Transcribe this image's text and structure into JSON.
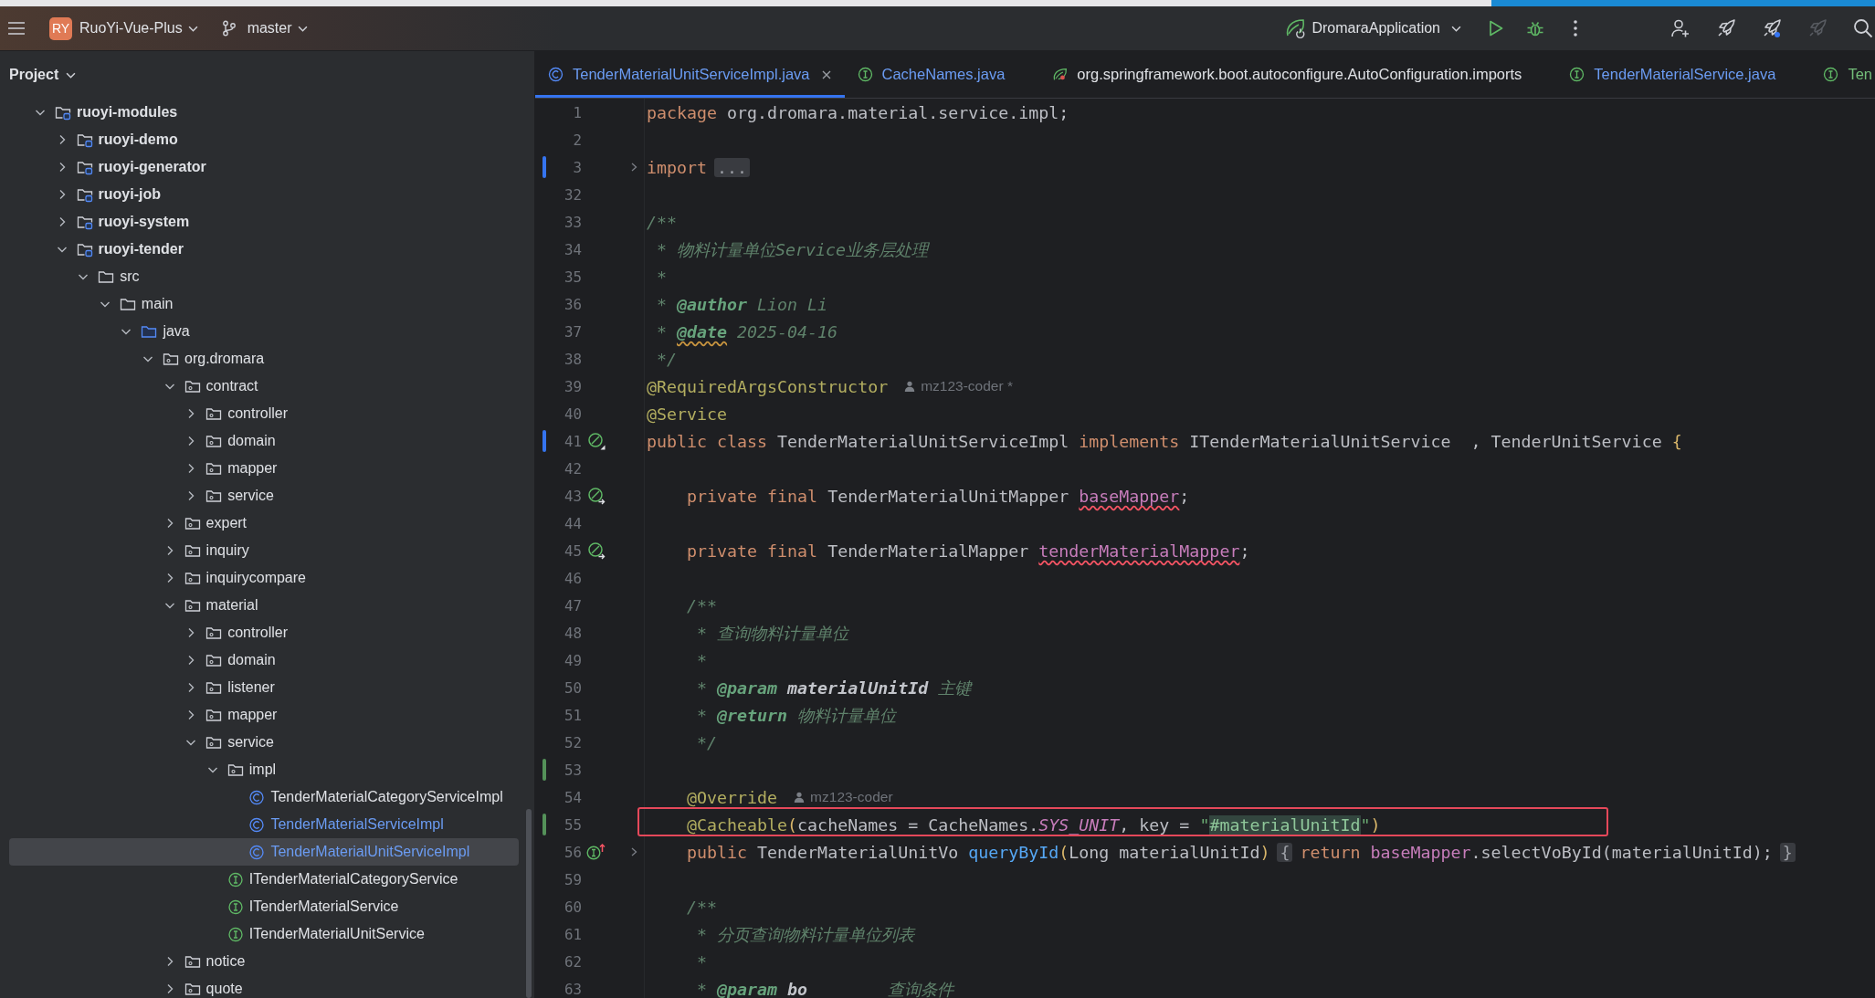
{
  "title_bar": {
    "project_badge": "RY",
    "project": "RuoYi-Vue-Plus",
    "branch": "master",
    "run_config": "DromaraApplication",
    "actions": [
      {
        "kind": "add-user",
        "disabled": false
      },
      {
        "kind": "rocket",
        "disabled": false
      },
      {
        "kind": "rocket-badge",
        "disabled": false
      },
      {
        "kind": "rocket",
        "disabled": true
      },
      {
        "kind": "search",
        "disabled": false
      }
    ]
  },
  "project_panel": {
    "title": "Project",
    "tree": [
      {
        "label": "ruoyi-modules",
        "kind": "module",
        "expanded": true,
        "selected": false,
        "children": [
          {
            "label": "ruoyi-demo",
            "kind": "module",
            "expanded": false,
            "selected": false
          },
          {
            "label": "ruoyi-generator",
            "kind": "module",
            "expanded": false,
            "selected": false
          },
          {
            "label": "ruoyi-job",
            "kind": "module",
            "expanded": false,
            "selected": false
          },
          {
            "label": "ruoyi-system",
            "kind": "module",
            "expanded": false,
            "selected": false
          },
          {
            "label": "ruoyi-tender",
            "kind": "module",
            "expanded": true,
            "selected": false,
            "children": [
              {
                "label": "src",
                "kind": "folder",
                "expanded": true,
                "selected": false,
                "children": [
                  {
                    "label": "main",
                    "kind": "folder",
                    "expanded": true,
                    "selected": false,
                    "children": [
                      {
                        "label": "java",
                        "kind": "source-root",
                        "expanded": true,
                        "selected": false,
                        "children": [
                          {
                            "label": "org.dromara",
                            "kind": "package",
                            "expanded": true,
                            "selected": false,
                            "children": [
                              {
                                "label": "contract",
                                "kind": "package",
                                "expanded": true,
                                "selected": false,
                                "children": [
                                  {
                                    "label": "controller",
                                    "kind": "package",
                                    "expanded": false,
                                    "selected": false
                                  },
                                  {
                                    "label": "domain",
                                    "kind": "package",
                                    "expanded": false,
                                    "selected": false
                                  },
                                  {
                                    "label": "mapper",
                                    "kind": "package",
                                    "expanded": false,
                                    "selected": false
                                  },
                                  {
                                    "label": "service",
                                    "kind": "package",
                                    "expanded": false,
                                    "selected": false
                                  }
                                ]
                              },
                              {
                                "label": "expert",
                                "kind": "package",
                                "expanded": false,
                                "selected": false
                              },
                              {
                                "label": "inquiry",
                                "kind": "package",
                                "expanded": false,
                                "selected": false
                              },
                              {
                                "label": "inquirycompare",
                                "kind": "package",
                                "expanded": false,
                                "selected": false
                              },
                              {
                                "label": "material",
                                "kind": "package",
                                "expanded": true,
                                "selected": false,
                                "children": [
                                  {
                                    "label": "controller",
                                    "kind": "package",
                                    "expanded": false,
                                    "selected": false
                                  },
                                  {
                                    "label": "domain",
                                    "kind": "package",
                                    "expanded": false,
                                    "selected": false
                                  },
                                  {
                                    "label": "listener",
                                    "kind": "package",
                                    "expanded": false,
                                    "selected": false
                                  },
                                  {
                                    "label": "mapper",
                                    "kind": "package",
                                    "expanded": false,
                                    "selected": false
                                  },
                                  {
                                    "label": "service",
                                    "kind": "package",
                                    "expanded": true,
                                    "selected": false,
                                    "children": [
                                      {
                                        "label": "impl",
                                        "kind": "package",
                                        "expanded": true,
                                        "selected": false,
                                        "children": [
                                          {
                                            "label": "TenderMaterialCategoryServiceImpl",
                                            "kind": "class",
                                            "modified": false,
                                            "selected": false
                                          },
                                          {
                                            "label": "TenderMaterialServiceImpl",
                                            "kind": "class",
                                            "modified": true,
                                            "selected": false
                                          },
                                          {
                                            "label": "TenderMaterialUnitServiceImpl",
                                            "kind": "class",
                                            "modified": true,
                                            "selected": true
                                          }
                                        ]
                                      },
                                      {
                                        "label": "ITenderMaterialCategoryService",
                                        "kind": "interface",
                                        "modified": false,
                                        "selected": false
                                      },
                                      {
                                        "label": "ITenderMaterialService",
                                        "kind": "interface",
                                        "modified": false,
                                        "selected": false
                                      },
                                      {
                                        "label": "ITenderMaterialUnitService",
                                        "kind": "interface",
                                        "modified": false,
                                        "selected": false
                                      }
                                    ]
                                  }
                                ]
                              },
                              {
                                "label": "notice",
                                "kind": "package",
                                "expanded": false,
                                "selected": false
                              },
                              {
                                "label": "quote",
                                "kind": "package",
                                "expanded": false,
                                "selected": false
                              }
                            ]
                          }
                        ]
                      }
                    ]
                  }
                ]
              }
            ]
          }
        ]
      }
    ]
  },
  "editor": {
    "tabs": [
      {
        "label": "TenderMaterialUnitServiceImpl.java",
        "kind": "class",
        "modified": true,
        "added": false,
        "selected": true
      },
      {
        "label": "CacheNames.java",
        "kind": "interface",
        "modified": true,
        "added": false,
        "selected": false
      },
      {
        "label": "org.springframework.boot.autoconfigure.AutoConfiguration.imports",
        "kind": "spring-config",
        "modified": false,
        "added": false,
        "selected": false
      },
      {
        "label": "TenderMaterialService.java",
        "kind": "interface",
        "modified": true,
        "added": false,
        "selected": false
      },
      {
        "label": "Ten",
        "kind": "interface",
        "modified": false,
        "added": true,
        "selected": false
      }
    ],
    "lines": [
      {
        "number": "1",
        "tokens": [
          {
            "kind": "keyword",
            "text": "package"
          },
          {
            "kind": "plain",
            "text": " org.dromara.material.service.impl;"
          }
        ]
      },
      {
        "number": "2"
      },
      {
        "number": "3",
        "modified": true,
        "folded": true,
        "tokens": [
          {
            "kind": "keyword",
            "text": "import "
          },
          {
            "kind": "fold",
            "text": "..."
          }
        ]
      },
      {
        "number": "32"
      },
      {
        "number": "33",
        "tokens": [
          {
            "kind": "comment",
            "text": "/**"
          }
        ]
      },
      {
        "number": "34",
        "tokens": [
          {
            "kind": "comment",
            "text": " * 物料计量单位Service业务层处理"
          }
        ]
      },
      {
        "number": "35",
        "tokens": [
          {
            "kind": "comment",
            "text": " *"
          }
        ]
      },
      {
        "number": "36",
        "tokens": [
          {
            "kind": "comment",
            "text": " * "
          },
          {
            "kind": "doc_tag",
            "text": "@author"
          },
          {
            "kind": "comment",
            "text": " Lion Li"
          }
        ]
      },
      {
        "number": "37",
        "tokens": [
          {
            "kind": "comment",
            "text": " * "
          },
          {
            "kind": "doc_tag_warned",
            "text": "@date"
          },
          {
            "kind": "comment",
            "text": " 2025-04-16"
          }
        ]
      },
      {
        "number": "38",
        "tokens": [
          {
            "kind": "comment",
            "text": " */"
          }
        ]
      },
      {
        "number": "39",
        "tokens": [
          {
            "kind": "annotation",
            "text": "@RequiredArgsConstructor"
          },
          {
            "kind": "author_hint",
            "text": "mz123-coder *"
          }
        ]
      },
      {
        "number": "40",
        "tokens": [
          {
            "kind": "annotation",
            "text": "@Service"
          }
        ]
      },
      {
        "number": "41",
        "modified": true,
        "gutter": {
          "kind": "bean"
        },
        "tokens": [
          {
            "kind": "keyword",
            "text": "public class"
          },
          {
            "kind": "plain",
            "text": " TenderMaterialUnitServiceImpl "
          },
          {
            "kind": "keyword",
            "text": "implements"
          },
          {
            "kind": "plain",
            "text": " ITenderMaterialUnitService  , TenderUnitService "
          },
          {
            "kind": "brace",
            "text": "{"
          }
        ]
      },
      {
        "number": "42"
      },
      {
        "number": "43",
        "gutter": {
          "kind": "injected"
        },
        "tokens": [
          {
            "kind": "keyword",
            "text": "    private final"
          },
          {
            "kind": "plain",
            "text": " TenderMaterialUnitMapper "
          },
          {
            "kind": "field_warned",
            "text": "baseMapper"
          },
          {
            "kind": "plain",
            "text": ";"
          }
        ]
      },
      {
        "number": "44"
      },
      {
        "number": "45",
        "gutter": {
          "kind": "injected"
        },
        "tokens": [
          {
            "kind": "keyword",
            "text": "    private final"
          },
          {
            "kind": "plain",
            "text": " TenderMaterialMapper "
          },
          {
            "kind": "field_warned",
            "text": "tenderMaterialMapper"
          },
          {
            "kind": "plain",
            "text": ";"
          }
        ]
      },
      {
        "number": "46"
      },
      {
        "number": "47",
        "tokens": [
          {
            "kind": "comment",
            "text": "    /**"
          }
        ]
      },
      {
        "number": "48",
        "tokens": [
          {
            "kind": "comment",
            "text": "     * 查询物料计量单位"
          }
        ]
      },
      {
        "number": "49",
        "tokens": [
          {
            "kind": "comment",
            "text": "     *"
          }
        ]
      },
      {
        "number": "50",
        "tokens": [
          {
            "kind": "comment",
            "text": "     * "
          },
          {
            "kind": "doc_tag",
            "text": "@param"
          },
          {
            "kind": "doc_value",
            "text": " materialUnitId"
          },
          {
            "kind": "comment",
            "text": " 主键"
          }
        ]
      },
      {
        "number": "51",
        "tokens": [
          {
            "kind": "comment",
            "text": "     * "
          },
          {
            "kind": "doc_tag",
            "text": "@return"
          },
          {
            "kind": "comment",
            "text": " 物料计量单位"
          }
        ]
      },
      {
        "number": "52",
        "tokens": [
          {
            "kind": "comment",
            "text": "     */"
          }
        ]
      },
      {
        "number": "53",
        "added": true
      },
      {
        "number": "54",
        "tokens": [
          {
            "kind": "annotation",
            "text": "    @Override"
          },
          {
            "kind": "author_hint",
            "text": "mz123-coder"
          }
        ]
      },
      {
        "number": "55",
        "added": true,
        "boxed": true,
        "tokens": [
          {
            "kind": "annotation",
            "text": "    @Cacheable"
          },
          {
            "kind": "brace",
            "text": "("
          },
          {
            "kind": "plain",
            "text": "cacheNames = CacheNames."
          },
          {
            "kind": "constant",
            "text": "SYS_UNIT"
          },
          {
            "kind": "plain",
            "text": ", key = "
          },
          {
            "kind": "string",
            "text": "\""
          },
          {
            "kind": "string_match",
            "text": "#materialUnitId"
          },
          {
            "kind": "string",
            "text": "\""
          },
          {
            "kind": "brace",
            "text": ")"
          }
        ]
      },
      {
        "number": "56",
        "folded": true,
        "gutter": {
          "kind": "implements"
        },
        "tokens": [
          {
            "kind": "keyword",
            "text": "    public"
          },
          {
            "kind": "plain",
            "text": " TenderMaterialUnitVo "
          },
          {
            "kind": "method",
            "text": "queryById"
          },
          {
            "kind": "brace",
            "text": "("
          },
          {
            "kind": "plain",
            "text": "Long materialUnitId"
          },
          {
            "kind": "brace",
            "text": ") "
          },
          {
            "kind": "fold",
            "text": "{"
          },
          {
            "kind": "keyword",
            "text": " return "
          },
          {
            "kind": "field",
            "text": "baseMapper"
          },
          {
            "kind": "plain",
            "text": ".selectVoById(materialUnitId); "
          },
          {
            "kind": "fold",
            "text": "}"
          }
        ]
      },
      {
        "number": "59"
      },
      {
        "number": "60",
        "tokens": [
          {
            "kind": "comment",
            "text": "    /**"
          }
        ]
      },
      {
        "number": "61",
        "tokens": [
          {
            "kind": "comment",
            "text": "     * 分页查询物料计量单位列表"
          }
        ]
      },
      {
        "number": "62",
        "tokens": [
          {
            "kind": "comment",
            "text": "     *"
          }
        ]
      },
      {
        "number": "63",
        "tokens": [
          {
            "kind": "comment",
            "text": "     * "
          },
          {
            "kind": "doc_tag",
            "text": "@param"
          },
          {
            "kind": "doc_value",
            "text": " bo"
          },
          {
            "kind": "comment",
            "text": "        查询条件"
          }
        ]
      }
    ]
  }
}
